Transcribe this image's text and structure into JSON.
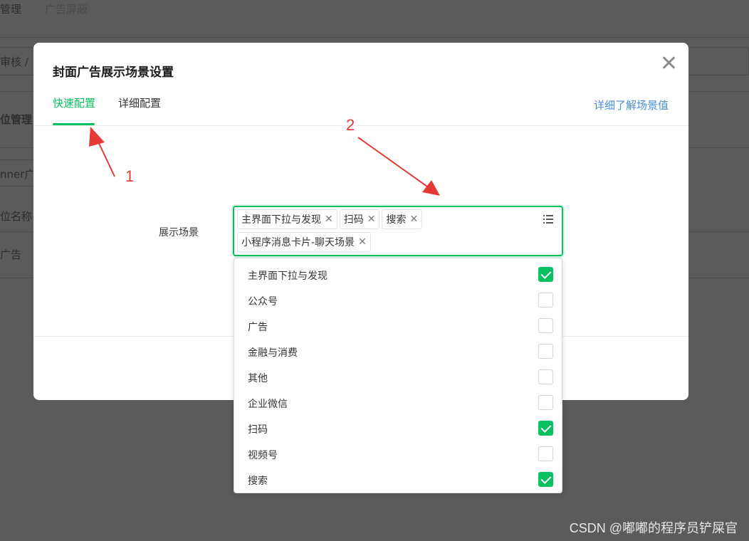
{
  "background": {
    "nav_items": [
      "管理",
      "广告屏蔽"
    ],
    "texts": [
      "审核 /",
      "位管理",
      "nner广告",
      "位名称",
      "广告"
    ]
  },
  "modal": {
    "title": "封面广告展示场景设置",
    "tabs": [
      {
        "label": "快速配置",
        "active": true
      },
      {
        "label": "详细配置",
        "active": false
      }
    ],
    "learn_more": "详细了解场景值",
    "field_label": "展示场景",
    "selected_chips": [
      "主界面下拉与发现",
      "扫码",
      "搜索",
      "小程序消息卡片-聊天场景"
    ],
    "chip_remove_glyph": "✕",
    "options": [
      {
        "label": "主界面下拉与发现",
        "checked": true
      },
      {
        "label": "公众号",
        "checked": false
      },
      {
        "label": "广告",
        "checked": false
      },
      {
        "label": "金融与消费",
        "checked": false
      },
      {
        "label": "其他",
        "checked": false
      },
      {
        "label": "企业微信",
        "checked": false
      },
      {
        "label": "扫码",
        "checked": true
      },
      {
        "label": "视频号",
        "checked": false
      },
      {
        "label": "搜索",
        "checked": true
      }
    ]
  },
  "annotations": [
    "1",
    "2"
  ],
  "watermark": "CSDN @嘟嘟的程序员铲屎官",
  "colors": {
    "accent": "#07c160",
    "link": "#4a8fd6",
    "annotation": "#e53935",
    "overlay": "#5b5b5b"
  }
}
